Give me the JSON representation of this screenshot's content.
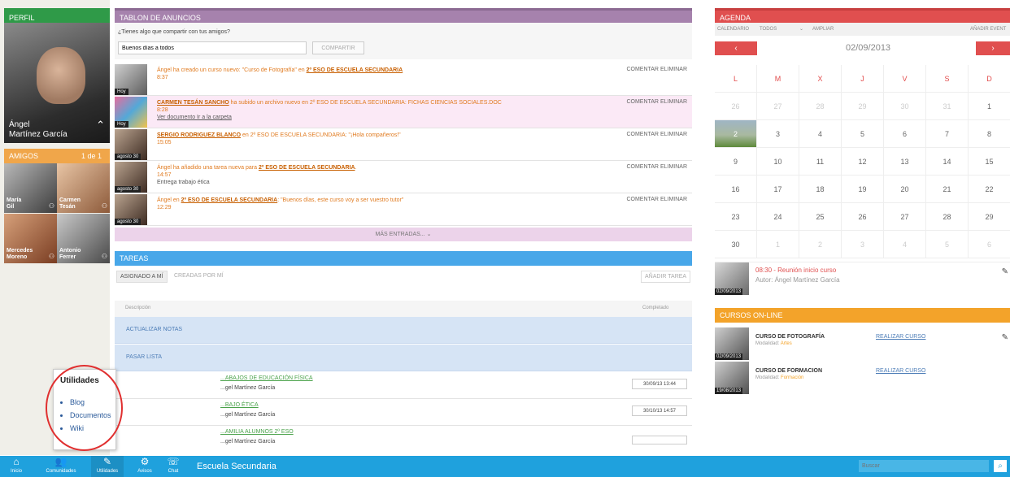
{
  "profile": {
    "header": "PERFIL",
    "first_name": "Ángel",
    "last_name": "Martínez García"
  },
  "friends": {
    "header": "AMIGOS",
    "count": "1 de 1",
    "list": [
      {
        "name1": "María",
        "name2": "Gil"
      },
      {
        "name1": "Carmen",
        "name2": "Tesán"
      },
      {
        "name1": "Mercedes",
        "name2": "Moreno"
      },
      {
        "name1": "Antonio",
        "name2": "Ferrer"
      }
    ]
  },
  "board": {
    "header": "TABLON DE ANUNCIOS",
    "prompt": "¿Tienes algo que compartir con tus amigos?",
    "input_value": "Buenos días a todos",
    "share_label": "COMPARTIR",
    "comment": "COMENTAR",
    "delete": "ELIMINAR",
    "more": "MÁS ENTRADAS...",
    "posts": [
      {
        "date": "Hoy",
        "pre": "Ángel ha creado un curso nuevo: \"Curso de Fotografía\" en ",
        "link": "2º ESO DE ESCUELA SECUNDARIA",
        "post": "",
        "time": "8:37",
        "extra": ""
      },
      {
        "date": "Hoy",
        "pre": "",
        "link": "CARMEN TESÁN SANCHO",
        "post": " ha subido un archivo nuevo en 2º ESO DE ESCUELA SECUNDARIA: FICHAS CIENCIAS SOCIALES.DOC",
        "time": "8:28",
        "extra": "Ver documento Ir a la carpeta"
      },
      {
        "date": "agosto 30",
        "pre": "",
        "link": "SERGIO RODRIGUEZ BLANCO",
        "post": " en 2º ESO DE ESCUELA SECUNDARIA: \"¡Hola compañeros!\"",
        "time": "15:05",
        "extra": ""
      },
      {
        "date": "agosto 30",
        "pre": "Ángel ha añadido una tarea nueva para ",
        "link": "2º ESO DE ESCUELA SECUNDARIA",
        "post": ".",
        "time": "14:57",
        "extra": "Entrega trabajo ética"
      },
      {
        "date": "agosto 30",
        "pre": "Ángel en ",
        "link": "2º ESO DE ESCUELA SECUNDARIA",
        "post": ": \"Buenos días, este curso voy a ser vuestro tutor\"",
        "time": "12:29",
        "extra": ""
      }
    ]
  },
  "tasks": {
    "header": "TAREAS",
    "tab1": "ASIGNADO A MÍ",
    "tab2": "CREADAS POR MÍ",
    "add": "AÑADIR TAREA",
    "col1": "Descripción",
    "col2": "Completado",
    "rows": [
      "ACTUALIZAR NOTAS",
      "PASAR LISTA"
    ],
    "items": [
      {
        "title": "...ABAJOS DE EDUCACIÓN FÍSICA",
        "author": "...gel Martínez García",
        "date": "30/09/13 13:44"
      },
      {
        "title": "...BAJO ÉTICA",
        "author": "...gel Martínez García",
        "date": "30/10/13 14:57"
      },
      {
        "title": "...AMILIA ALUMNOS 2º ESO",
        "author": "...gel Martínez García",
        "date": ""
      }
    ]
  },
  "agenda": {
    "header": "AGENDA",
    "toolbar_cal": "CALENDARIO",
    "toolbar_all": "TODOS",
    "toolbar_expand": "AMPLIAR",
    "toolbar_add": "AÑADIR EVENT",
    "date": "02/09/2013",
    "days": [
      "L",
      "M",
      "X",
      "J",
      "V",
      "S",
      "D"
    ],
    "weeks": [
      [
        "26",
        "27",
        "28",
        "29",
        "30",
        "31",
        "1"
      ],
      [
        "2",
        "3",
        "4",
        "5",
        "6",
        "7",
        "8"
      ],
      [
        "9",
        "10",
        "11",
        "12",
        "13",
        "14",
        "15"
      ],
      [
        "16",
        "17",
        "18",
        "19",
        "20",
        "21",
        "22"
      ],
      [
        "23",
        "24",
        "25",
        "26",
        "27",
        "28",
        "29"
      ],
      [
        "30",
        "1",
        "2",
        "3",
        "4",
        "5",
        "6"
      ]
    ],
    "event_time": "08:30",
    "event_title": "- Reunión inicio curso",
    "event_author": "Autor: Ángel Martínez García",
    "event_date": "02/09/2013"
  },
  "courses": {
    "header": "CURSOS ON-LINE",
    "action": "REALIZAR CURSO",
    "list": [
      {
        "title": "CURSO DE FOTOGRAFÍA",
        "mod_label": "Modalidad:",
        "mod": "Artes",
        "date": "02/09/2013"
      },
      {
        "title": "CURSO DE FORMACION",
        "mod_label": "Modalidad:",
        "mod": "Formación",
        "date": "19/08/2013"
      }
    ]
  },
  "utilities_menu": {
    "title": "Utilidades",
    "items": [
      "Blog",
      "Documentos",
      "Wiki"
    ]
  },
  "bottom": {
    "site": "Escuela Secundaria",
    "search_placeholder": "Buscar",
    "nav": [
      {
        "label": "Inicio",
        "icon": "⌂"
      },
      {
        "label": "Comunidades",
        "icon": "👥"
      },
      {
        "label": "Utilidades",
        "icon": "✎"
      },
      {
        "label": "Avisos",
        "icon": "⚙"
      },
      {
        "label": "Chat",
        "icon": "☏"
      }
    ]
  }
}
